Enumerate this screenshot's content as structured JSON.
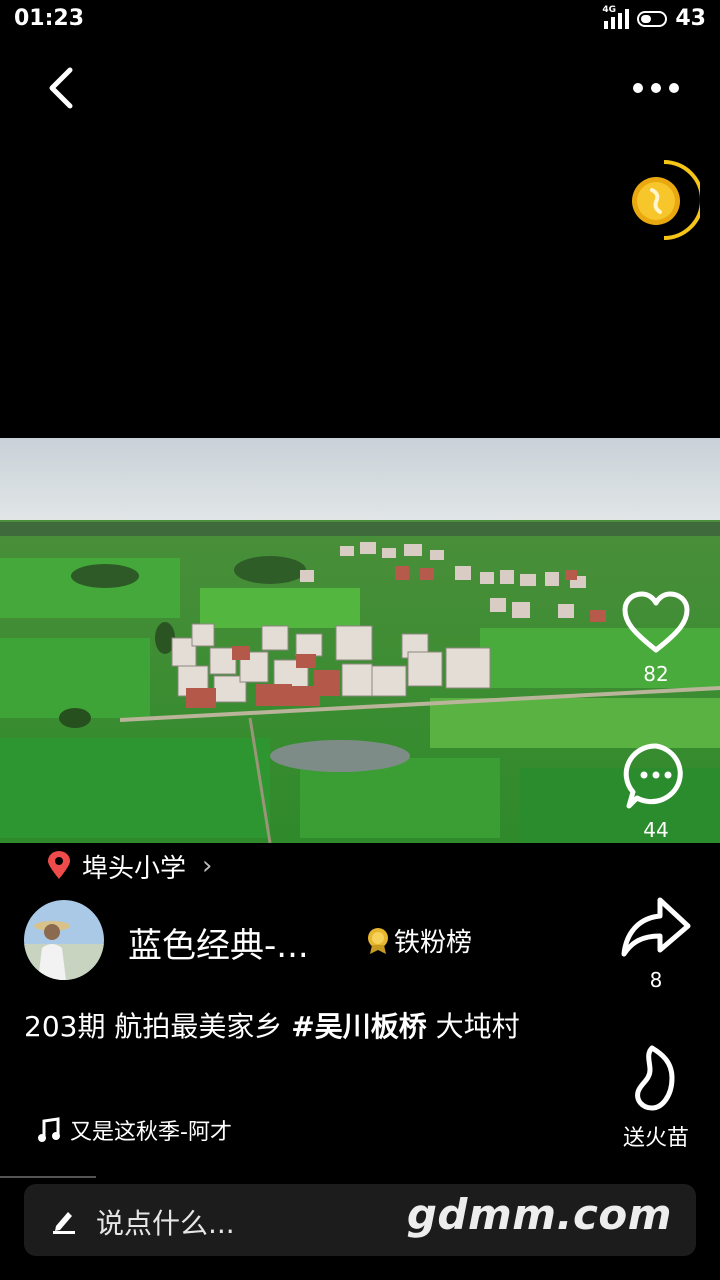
{
  "status_bar": {
    "time": "01:23",
    "network": "4G",
    "battery": "43"
  },
  "nav": {
    "back_icon": "chevron-left-icon",
    "more_icon": "more-horizontal-icon"
  },
  "coin_widget": {
    "icon": "gold-coin-icon",
    "color": "#f5c518"
  },
  "video": {
    "description_icon": "aerial-village-photo"
  },
  "actions": {
    "like_count": "82",
    "comment_count": "44",
    "share_count": "8",
    "gift_label": "送火苗"
  },
  "location": {
    "name": "埠头小学"
  },
  "author": {
    "name": "蓝色经典-...",
    "badge_label": "铁粉榜"
  },
  "caption": {
    "prefix": "203期 航拍最美家乡 ",
    "hashtag": "#吴川板桥",
    "suffix": "  大坉村"
  },
  "music": {
    "title": "又是这秋季-阿才"
  },
  "comment_bar": {
    "placeholder": "说点什么...",
    "watermark": "gdmm.com"
  },
  "colors": {
    "location_pin": "#f04b4b",
    "badge_gold": "#e8b730",
    "accent": "#f5c518"
  }
}
